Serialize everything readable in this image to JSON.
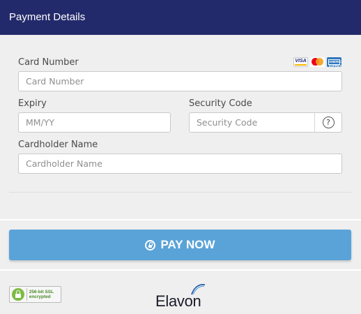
{
  "header": {
    "title": "Payment Details"
  },
  "card_number": {
    "label": "Card Number",
    "placeholder": "Card Number",
    "value": ""
  },
  "card_brands": [
    "VISA",
    "Mastercard",
    "American Express"
  ],
  "card_brand_labels": {
    "visa": "VISA",
    "amex": "AMERICAN EXPRESS"
  },
  "expiry": {
    "label": "Expiry",
    "placeholder": "MM/YY",
    "value": ""
  },
  "security_code": {
    "label": "Security Code",
    "placeholder": "Security Code",
    "value": "",
    "help_label": "?"
  },
  "cardholder": {
    "label": "Cardholder Name",
    "placeholder": "Cardholder Name",
    "value": ""
  },
  "pay_button": {
    "label": "PAY NOW",
    "color": "#5aa3d8"
  },
  "ssl_badge": {
    "line1": "256-bit SSL",
    "line2": "encrypted"
  },
  "brand": {
    "name": "Elavon"
  },
  "colors": {
    "header": "#232a6b",
    "panel": "#efefef",
    "ssl_green": "#7dbb42"
  }
}
